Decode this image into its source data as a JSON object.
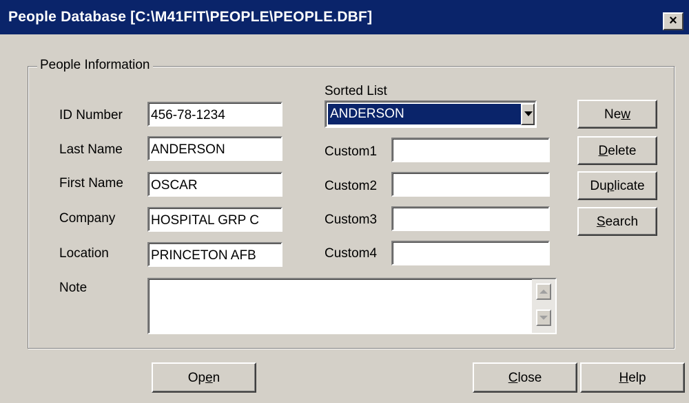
{
  "window": {
    "title": "People Database [C:\\M41FIT\\PEOPLE\\PEOPLE.DBF]",
    "close_glyph": "×"
  },
  "group": {
    "label": "People Information"
  },
  "fields": {
    "id_number": {
      "label": "ID Number",
      "value": "456-78-1234"
    },
    "last_name": {
      "label": "Last Name",
      "value": "ANDERSON"
    },
    "first_name": {
      "label": "First Name",
      "value": "OSCAR"
    },
    "company": {
      "label": "Company",
      "value": "HOSPITAL GRP C"
    },
    "location": {
      "label": "Location",
      "value": "PRINCETON AFB"
    },
    "note": {
      "label": "Note",
      "value": ""
    }
  },
  "sorted_list": {
    "label": "Sorted List",
    "value": "ANDERSON"
  },
  "custom": [
    {
      "label": "Custom1",
      "value": ""
    },
    {
      "label": "Custom2",
      "value": ""
    },
    {
      "label": "Custom3",
      "value": ""
    },
    {
      "label": "Custom4",
      "value": ""
    }
  ],
  "buttons": {
    "new": {
      "pre": "Ne",
      "key": "w",
      "post": ""
    },
    "delete": {
      "pre": "",
      "key": "D",
      "post": "elete"
    },
    "duplicate": {
      "pre": "Du",
      "key": "p",
      "post": "licate"
    },
    "search": {
      "pre": "",
      "key": "S",
      "post": "earch"
    },
    "open": {
      "pre": "Op",
      "key": "e",
      "post": "n"
    },
    "close": {
      "pre": "",
      "key": "C",
      "post": "lose"
    },
    "help": {
      "pre": "",
      "key": "H",
      "post": "elp"
    }
  },
  "colors": {
    "face": "#d4d0c8",
    "titlebar": "#0a246a",
    "selection": "#0a246a"
  }
}
